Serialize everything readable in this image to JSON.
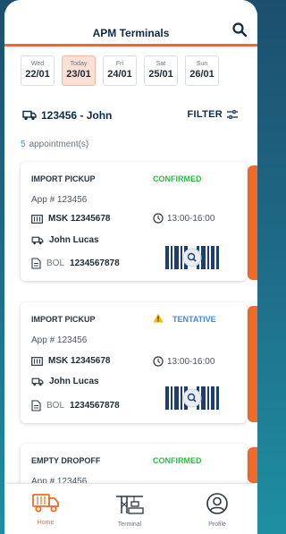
{
  "header": {
    "title": "APM Terminals"
  },
  "dates": [
    {
      "dow": "Wed",
      "dm": "22/01",
      "active": false
    },
    {
      "dow": "Today",
      "dm": "23/01",
      "active": true
    },
    {
      "dow": "Fri",
      "dm": "24/01",
      "active": false
    },
    {
      "dow": "Sat",
      "dm": "25/01",
      "active": false
    },
    {
      "dow": "Sun",
      "dm": "26/01",
      "active": false
    }
  ],
  "truck": {
    "label": "123456 - John"
  },
  "filter": {
    "label": "FILTER"
  },
  "summary": {
    "count": "5",
    "label": "appointment(s)"
  },
  "cards": [
    {
      "type": "IMPORT PICKUP",
      "status": "CONFIRMED",
      "status_color": "#2fb84a",
      "appnum": "App # 123456",
      "container": "MSK 12345678",
      "time": "13:00-16:00",
      "driver": "John Lucas",
      "bol_prefix": "BOL",
      "bol": "1234567878"
    },
    {
      "type": "IMPORT PICKUP",
      "status": "TENTATIVE",
      "status_color": "#3d8ae0",
      "appnum": "App # 123456",
      "container": "MSK 12345678",
      "time": "13:00-16:00",
      "driver": "John Lucas",
      "bol_prefix": "BOL",
      "bol": "1234567878"
    },
    {
      "type": "EMPTY DROPOFF",
      "status": "CONFIRMED",
      "status_color": "#2fb84a",
      "appnum": "App # 123456"
    }
  ],
  "nav": [
    {
      "label": "Home",
      "icon": "truck-icon",
      "active": true
    },
    {
      "label": "Terminal",
      "icon": "crane-icon",
      "active": false
    },
    {
      "label": "Profile",
      "icon": "user-icon",
      "active": false
    }
  ],
  "colors": {
    "accent": "#f26b1d",
    "navy": "#0c2a47",
    "confirmed": "#2fb84a",
    "tentative": "#3d8ae0",
    "barcode": "#1b3e73"
  }
}
